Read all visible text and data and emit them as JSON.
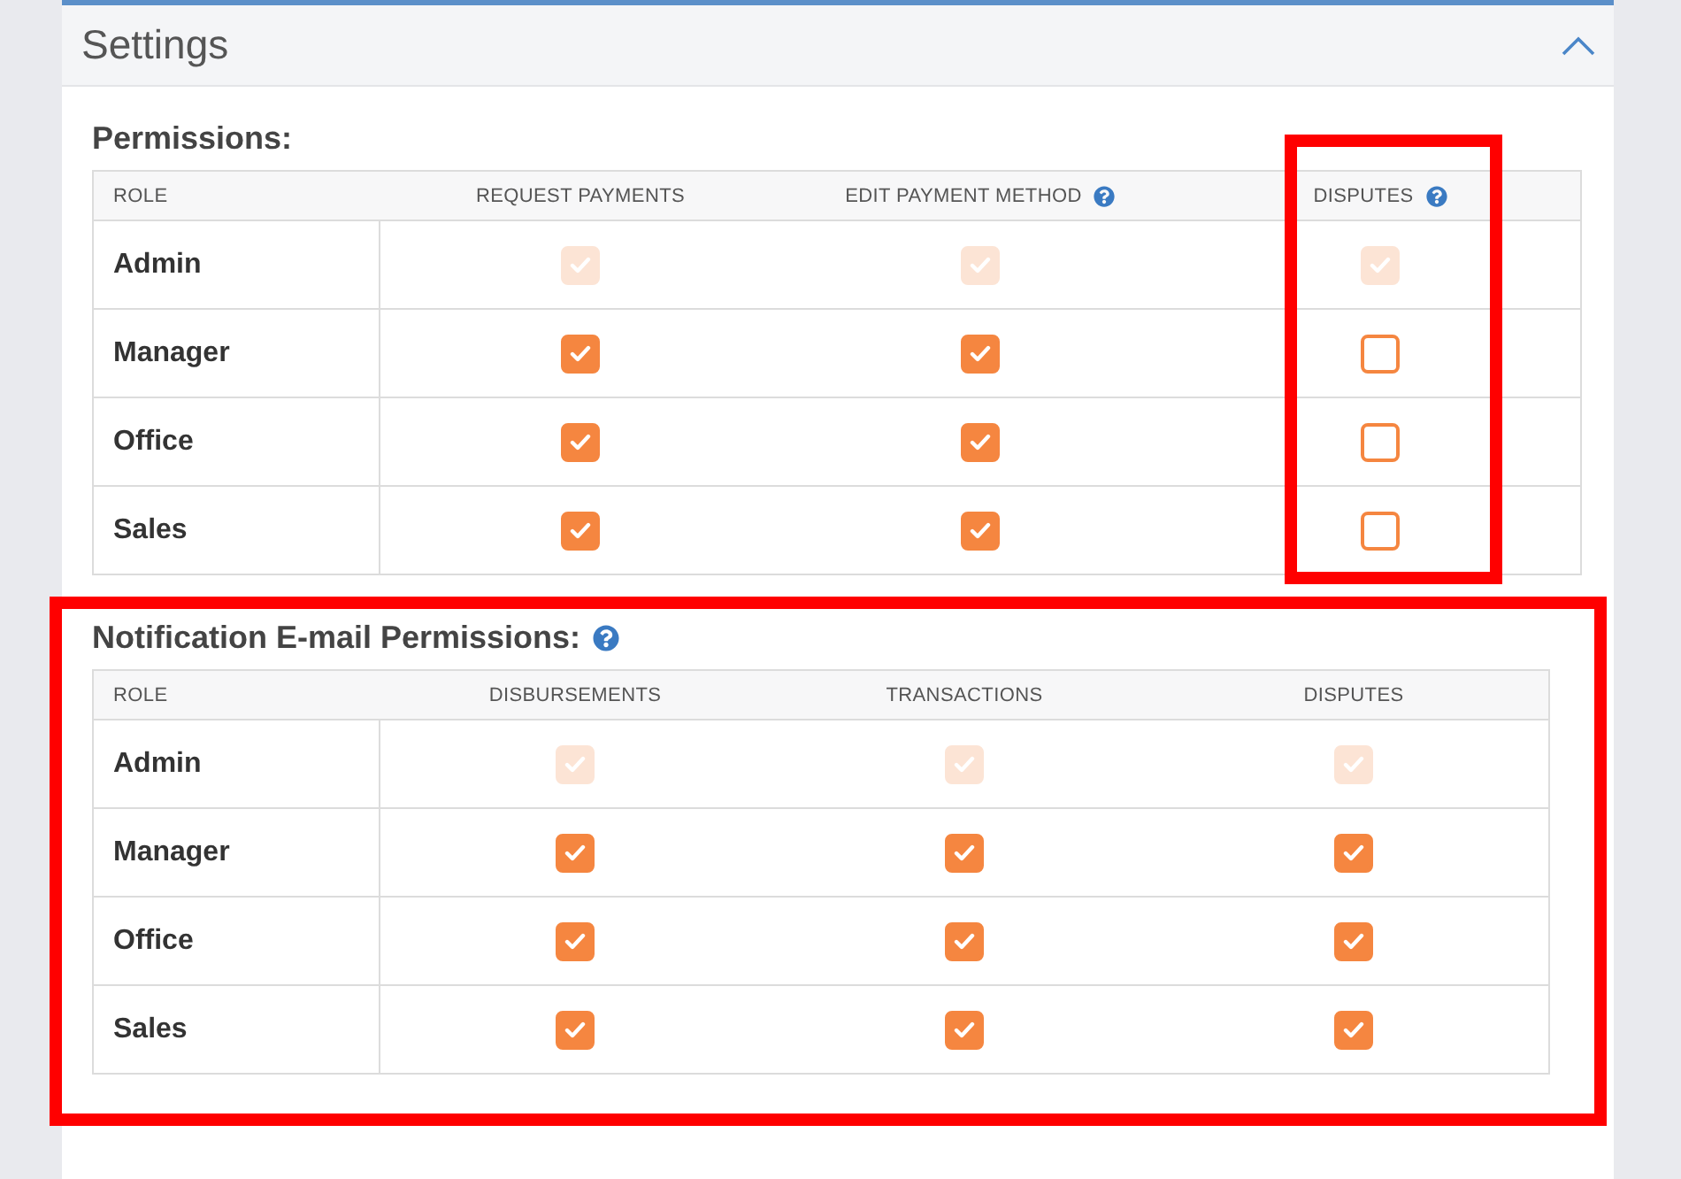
{
  "panel": {
    "title": "Settings",
    "expanded": true
  },
  "sections": [
    {
      "title": "Permissions:",
      "help": false,
      "highlighted": false,
      "columns": [
        {
          "label": "ROLE",
          "help": false,
          "highlighted": false
        },
        {
          "label": "REQUEST PAYMENTS",
          "help": false,
          "highlighted": false
        },
        {
          "label": "EDIT PAYMENT METHOD",
          "help": true,
          "highlighted": false
        },
        {
          "label": "DISPUTES",
          "help": true,
          "highlighted": true
        }
      ],
      "rows": [
        {
          "role": "Admin",
          "cells": [
            {
              "checked": true,
              "disabled": true
            },
            {
              "checked": true,
              "disabled": true
            },
            {
              "checked": true,
              "disabled": true
            }
          ]
        },
        {
          "role": "Manager",
          "cells": [
            {
              "checked": true,
              "disabled": false
            },
            {
              "checked": true,
              "disabled": false
            },
            {
              "checked": false,
              "disabled": false
            }
          ]
        },
        {
          "role": "Office",
          "cells": [
            {
              "checked": true,
              "disabled": false
            },
            {
              "checked": true,
              "disabled": false
            },
            {
              "checked": false,
              "disabled": false
            }
          ]
        },
        {
          "role": "Sales",
          "cells": [
            {
              "checked": true,
              "disabled": false
            },
            {
              "checked": true,
              "disabled": false
            },
            {
              "checked": false,
              "disabled": false
            }
          ]
        }
      ]
    },
    {
      "title": "Notification E-mail Permissions:",
      "help": true,
      "highlighted": true,
      "columns": [
        {
          "label": "ROLE",
          "help": false,
          "highlighted": false
        },
        {
          "label": "DISBURSEMENTS",
          "help": false,
          "highlighted": false
        },
        {
          "label": "TRANSACTIONS",
          "help": false,
          "highlighted": false
        },
        {
          "label": "DISPUTES",
          "help": false,
          "highlighted": false
        }
      ],
      "rows": [
        {
          "role": "Admin",
          "cells": [
            {
              "checked": true,
              "disabled": true
            },
            {
              "checked": true,
              "disabled": true
            },
            {
              "checked": true,
              "disabled": true
            }
          ]
        },
        {
          "role": "Manager",
          "cells": [
            {
              "checked": true,
              "disabled": false
            },
            {
              "checked": true,
              "disabled": false
            },
            {
              "checked": true,
              "disabled": false
            }
          ]
        },
        {
          "role": "Office",
          "cells": [
            {
              "checked": true,
              "disabled": false
            },
            {
              "checked": true,
              "disabled": false
            },
            {
              "checked": true,
              "disabled": false
            }
          ]
        },
        {
          "role": "Sales",
          "cells": [
            {
              "checked": true,
              "disabled": false
            },
            {
              "checked": true,
              "disabled": false
            },
            {
              "checked": true,
              "disabled": false
            }
          ]
        }
      ]
    }
  ]
}
